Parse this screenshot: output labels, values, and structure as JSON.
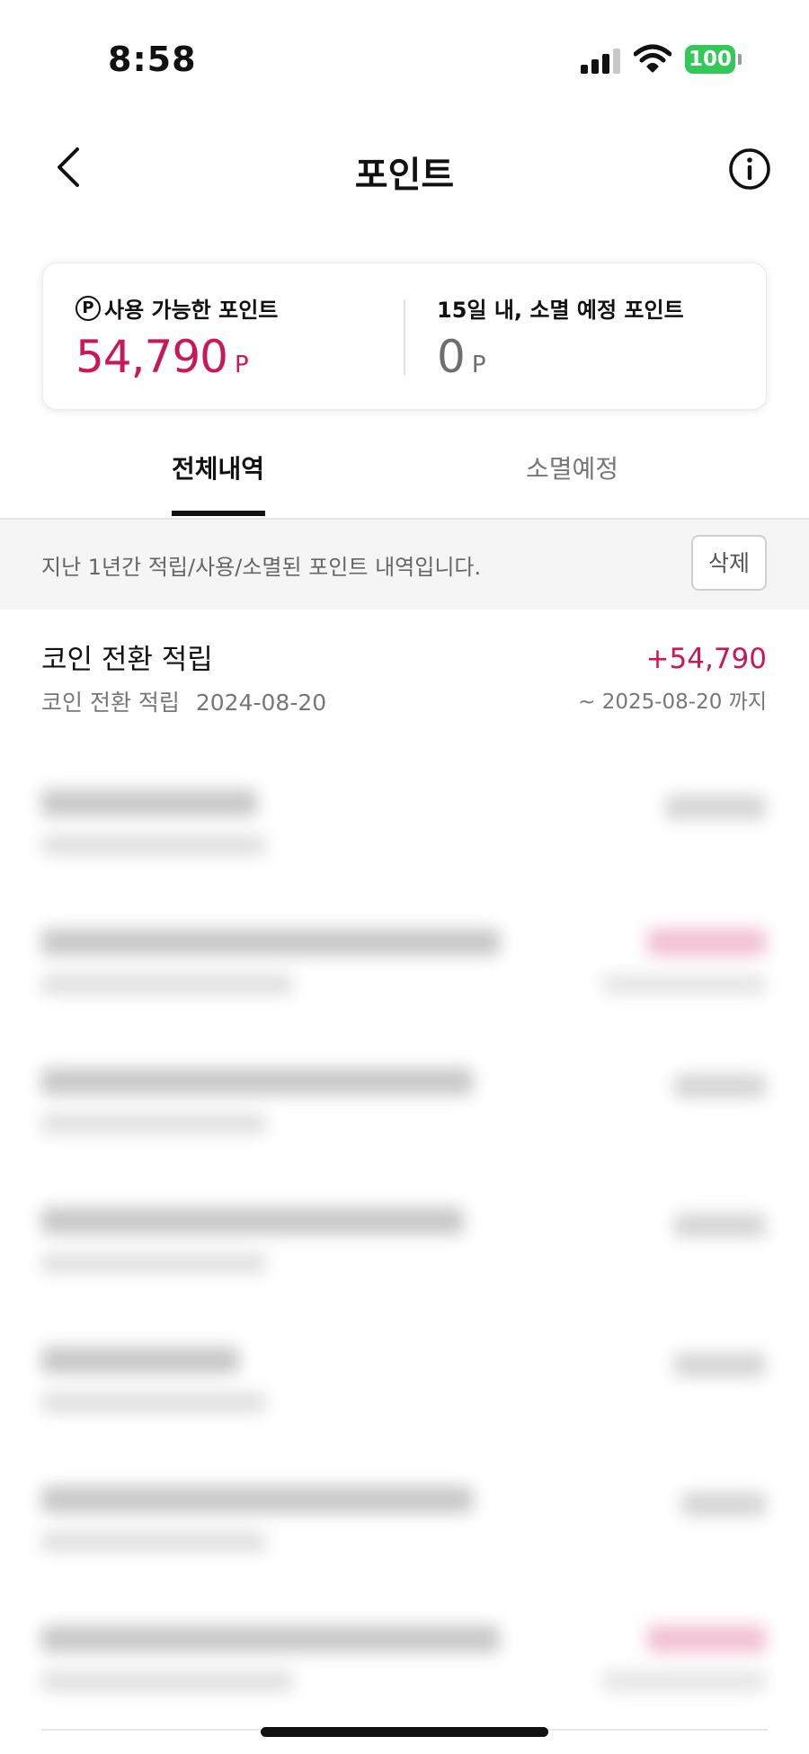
{
  "status_bar": {
    "time": "8:58",
    "battery": "100"
  },
  "header": {
    "title": "포인트"
  },
  "summary": {
    "available_label": "사용 가능한 포인트",
    "available_badge": "P",
    "available_value": "54,790",
    "available_unit": "P",
    "expiring_label": "15일 내, 소멸 예정 포인트",
    "expiring_value": "0",
    "expiring_unit": "P"
  },
  "tabs": [
    {
      "label": "전체내역",
      "active": true
    },
    {
      "label": "소멸예정",
      "active": false
    }
  ],
  "notice": {
    "text": "지난 1년간 적립/사용/소멸된 포인트 내역입니다.",
    "delete_label": "삭제"
  },
  "history": [
    {
      "title": "코인 전환 적립",
      "type": "코인 전환 적립",
      "date": "2024-08-20",
      "amount": "+54,790",
      "expiry": "~ 2025-08-20 까지"
    }
  ],
  "colors": {
    "accent": "#c8185a",
    "battery": "#34c759"
  }
}
